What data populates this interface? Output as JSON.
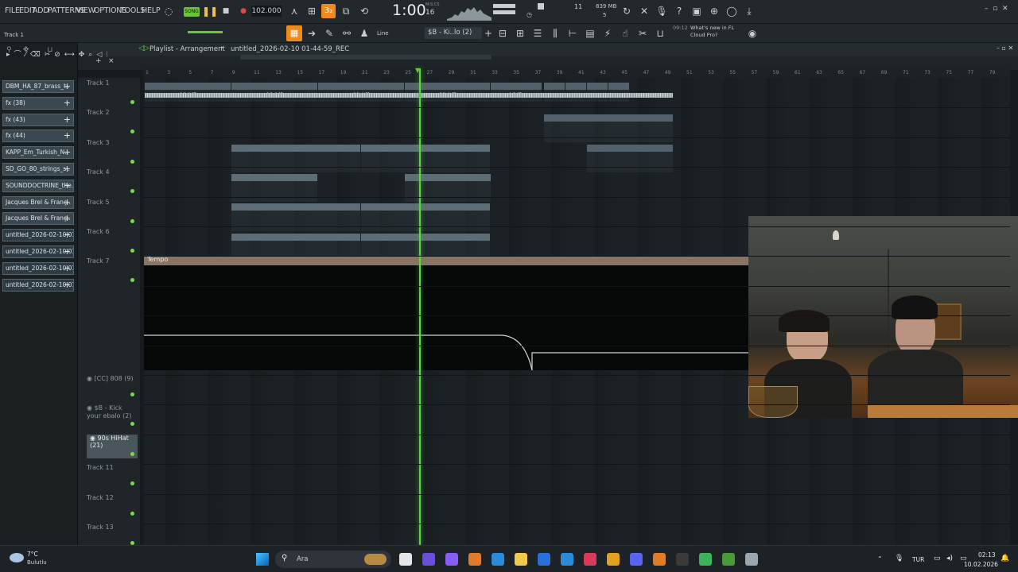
{
  "menu": [
    "FILE",
    "EDIT",
    "ADD",
    "PATTERNS",
    "VIEW",
    "OPTIONS",
    "TOOLS",
    "HELP"
  ],
  "transport": {
    "song_label": "SONG",
    "tempo": "102.000",
    "pattern_num": "3₂",
    "time": "1:00",
    "time_sub": "16",
    "time_unit": "M:S:CS",
    "mem": "839 MB",
    "voices": "11",
    "cpu": "5"
  },
  "hint": {
    "text": "Track 1"
  },
  "toolbar2": {
    "line": "Line",
    "pattern": "$B - Ki..lo (2)",
    "news_time": "09:12",
    "news": "What's new in FL Cloud Pro?"
  },
  "playlist": {
    "title": "Playlist - Arrangement",
    "file": "untitled_2026-02-10 01-44-59_REC"
  },
  "browser": [
    "DBM_HA_87_brass_t..",
    "fx (38)",
    "fx (43)",
    "fx (44)",
    "KAPP_Em_Turkish_N..",
    "SD_GO_80_strings_s..",
    "SOUNDDOCTRINE_the..",
    "Jacques Brel & Franç..",
    "Jacques Brel & Franç..",
    "untitled_2026-02-10 01-..",
    "untitled_2026-02-10 01-..",
    "untitled_2026-02-10 01-..",
    "untitled_2026-02-10 01-.."
  ],
  "ruler": [
    "1",
    "3",
    "5",
    "7",
    "9",
    "11",
    "13",
    "15",
    "17",
    "19",
    "21",
    "23",
    "25",
    "27",
    "29",
    "31",
    "33",
    "35",
    "37",
    "39",
    "41",
    "43",
    "45",
    "47",
    "49",
    "51",
    "53",
    "55",
    "57",
    "59",
    "61",
    "63",
    "65",
    "67",
    "69",
    "71",
    "73",
    "75",
    "77",
    "79"
  ],
  "tracks": [
    "Track 1",
    "Track 2",
    "Track 3",
    "Track 4",
    "Track 5",
    "Track 6",
    "Track 7"
  ],
  "extra_tracks": [
    "[CC] 808 (9)",
    "$B - Kick your ebalo (2)",
    "90s HiHat (21)",
    "Track 11",
    "Track 12",
    "Track 13"
  ],
  "clips": {
    "t1": [
      "DBM_HA_87_bra..aybachs_Emin",
      "DBM_HA_87_bra..aybachs_Emin",
      "DBM_HA_87_bra..aybachs_Emin",
      "DBM_HA_87_bra..aybachs_Emin",
      "DBM_H.._Emin",
      "3..val",
      "3..val",
      "3..val",
      "3..val"
    ],
    "t1_db": [
      "-10.4dB",
      "-10.4dB",
      "-10.4dB",
      "-10.4dB",
      "-4.3dB",
      "-4.3dB"
    ],
    "t2": [
      "[CC] 808 (9)",
      "[CC] 808 (9)",
      "[CC] 808 (9)"
    ],
    "t3": [
      "$B - Bass (18)",
      "$B - Bass (18)",
      "$B - Bass (18)",
      "$B - Bass (18)",
      "$B - Bass (18)",
      "$B - Bass (18)",
      "hat",
      "hat"
    ],
    "t4": [
      "HI HAT [..TS (9)",
      "HI HAT [..TS (9)",
      "HI HAT [..TS (9)",
      "HI HAT [..TS (9)"
    ],
    "t5": [
      "[Doja C..ap (3)",
      "[Doja C..ap (3)",
      "[Doja C..ap (3)",
      "[Doja C..ap (3)",
      "[Doja C..ap (3)",
      "[Doja C..ap (3)"
    ],
    "t6": [
      "Detroit..ick (9)",
      "Detroit..ick (9)",
      "Detroit..ick (9)",
      "Detroit..ick (9)",
      "Detroit..ick (9)",
      "Detroit..ick (9)"
    ],
    "tempo": "Tempo"
  },
  "taskbar": {
    "temp": "7°C",
    "weather": "Bulutlu",
    "search": "Ara",
    "lang": "TUR",
    "time": "02:13",
    "date": "10.02.2026"
  }
}
